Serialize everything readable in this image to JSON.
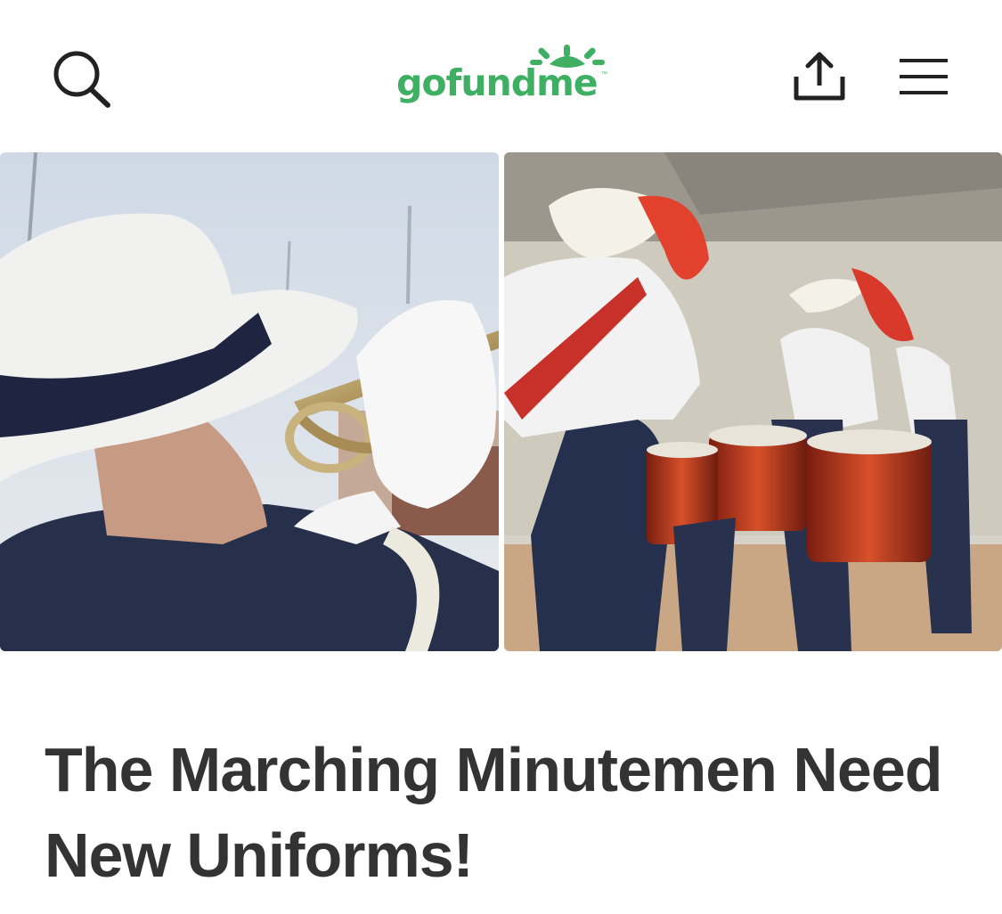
{
  "header": {
    "logo_text": "gofundme",
    "logo_tm": "™",
    "icons": {
      "search": "search-icon",
      "share": "share-icon",
      "menu": "hamburger-menu-icon"
    },
    "brand_color": "#3FAF63"
  },
  "gallery": {
    "images": [
      {
        "name": "trumpet-player-photo"
      },
      {
        "name": "drumline-photo"
      }
    ]
  },
  "campaign": {
    "title": "The Marching Minutemen Need New Uniforms!"
  },
  "colors": {
    "title_text": "#333333",
    "icon": "#222222"
  }
}
